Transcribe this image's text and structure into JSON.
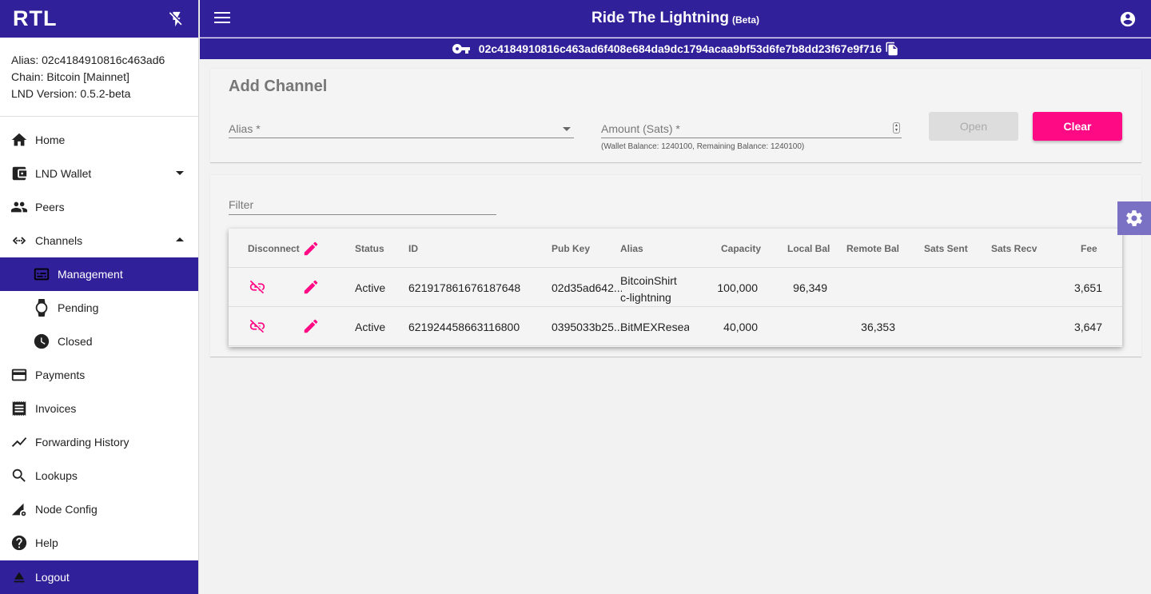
{
  "sidebar": {
    "logo": "RTL",
    "node_info": {
      "alias": "Alias: 02c4184910816c463ad6",
      "chain": "Chain: Bitcoin [Mainnet]",
      "version": "LND Version: 0.5.2-beta"
    },
    "items": [
      {
        "label": "Home",
        "icon": "home-icon"
      },
      {
        "label": "LND Wallet",
        "icon": "wallet-icon"
      },
      {
        "label": "Peers",
        "icon": "people-icon"
      },
      {
        "label": "Channels",
        "icon": "channels-icon"
      },
      {
        "label": "Management",
        "icon": "management-icon"
      },
      {
        "label": "Pending",
        "icon": "watch-icon"
      },
      {
        "label": "Closed",
        "icon": "clock-icon"
      },
      {
        "label": "Payments",
        "icon": "credit-card-icon"
      },
      {
        "label": "Invoices",
        "icon": "receipt-icon"
      },
      {
        "label": "Forwarding History",
        "icon": "trending-icon"
      },
      {
        "label": "Lookups",
        "icon": "search-icon"
      },
      {
        "label": "Node Config",
        "icon": "node-config-icon"
      },
      {
        "label": "Help",
        "icon": "help-icon"
      },
      {
        "label": "Logout",
        "icon": "eject-icon"
      }
    ]
  },
  "header": {
    "title": "Ride The Lightning",
    "beta": "(Beta)",
    "pubkey": "02c4184910816c463ad6f408e684da9dc1794acaa9bf53d6fe7b8dd23f67e9f716"
  },
  "add_channel": {
    "title": "Add Channel",
    "alias_label": "Alias *",
    "amount_label": "Amount (Sats) *",
    "balance_hint": "(Wallet Balance: 1240100, Remaining Balance: 1240100)",
    "open_label": "Open",
    "clear_label": "Clear"
  },
  "channels": {
    "filter_label": "Filter",
    "columns": [
      "Disconnect",
      "Status",
      "ID",
      "Pub Key",
      "Alias",
      "Capacity",
      "Local Bal",
      "Remote Bal",
      "Sats Sent",
      "Sats Recv",
      "Fee"
    ],
    "rows": [
      {
        "status": "Active",
        "id": "621917861676187648",
        "pubkey": "02d35ad642...",
        "alias": "BitcoinShirt c-lightning",
        "capacity": "100,000",
        "local": "96,349",
        "remote": "",
        "sent": "",
        "recv": "",
        "fee": "3,651"
      },
      {
        "status": "Active",
        "id": "621924458663116800",
        "pubkey": "0395033b25...",
        "alias": "BitMEXResear",
        "capacity": "40,000",
        "local": "",
        "remote": "36,353",
        "sent": "",
        "recv": "",
        "fee": "3,647"
      }
    ]
  },
  "colors": {
    "primary": "#30219a",
    "accent": "#ff0a85"
  }
}
